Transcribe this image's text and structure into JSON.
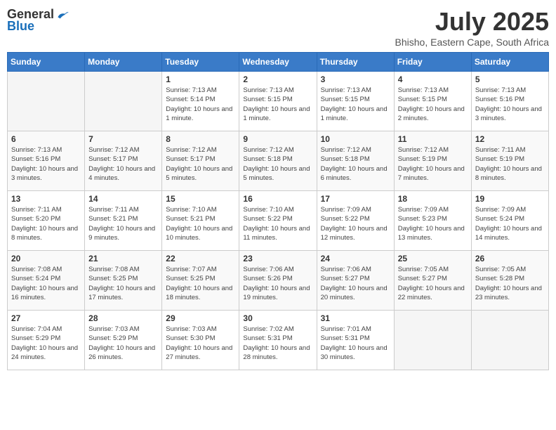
{
  "logo": {
    "general": "General",
    "blue": "Blue"
  },
  "title": "July 2025",
  "location": "Bhisho, Eastern Cape, South Africa",
  "weekdays": [
    "Sunday",
    "Monday",
    "Tuesday",
    "Wednesday",
    "Thursday",
    "Friday",
    "Saturday"
  ],
  "weeks": [
    [
      {
        "day": "",
        "info": ""
      },
      {
        "day": "",
        "info": ""
      },
      {
        "day": "1",
        "info": "Sunrise: 7:13 AM\nSunset: 5:14 PM\nDaylight: 10 hours and 1 minute."
      },
      {
        "day": "2",
        "info": "Sunrise: 7:13 AM\nSunset: 5:15 PM\nDaylight: 10 hours and 1 minute."
      },
      {
        "day": "3",
        "info": "Sunrise: 7:13 AM\nSunset: 5:15 PM\nDaylight: 10 hours and 1 minute."
      },
      {
        "day": "4",
        "info": "Sunrise: 7:13 AM\nSunset: 5:15 PM\nDaylight: 10 hours and 2 minutes."
      },
      {
        "day": "5",
        "info": "Sunrise: 7:13 AM\nSunset: 5:16 PM\nDaylight: 10 hours and 3 minutes."
      }
    ],
    [
      {
        "day": "6",
        "info": "Sunrise: 7:13 AM\nSunset: 5:16 PM\nDaylight: 10 hours and 3 minutes."
      },
      {
        "day": "7",
        "info": "Sunrise: 7:12 AM\nSunset: 5:17 PM\nDaylight: 10 hours and 4 minutes."
      },
      {
        "day": "8",
        "info": "Sunrise: 7:12 AM\nSunset: 5:17 PM\nDaylight: 10 hours and 5 minutes."
      },
      {
        "day": "9",
        "info": "Sunrise: 7:12 AM\nSunset: 5:18 PM\nDaylight: 10 hours and 5 minutes."
      },
      {
        "day": "10",
        "info": "Sunrise: 7:12 AM\nSunset: 5:18 PM\nDaylight: 10 hours and 6 minutes."
      },
      {
        "day": "11",
        "info": "Sunrise: 7:12 AM\nSunset: 5:19 PM\nDaylight: 10 hours and 7 minutes."
      },
      {
        "day": "12",
        "info": "Sunrise: 7:11 AM\nSunset: 5:19 PM\nDaylight: 10 hours and 8 minutes."
      }
    ],
    [
      {
        "day": "13",
        "info": "Sunrise: 7:11 AM\nSunset: 5:20 PM\nDaylight: 10 hours and 8 minutes."
      },
      {
        "day": "14",
        "info": "Sunrise: 7:11 AM\nSunset: 5:21 PM\nDaylight: 10 hours and 9 minutes."
      },
      {
        "day": "15",
        "info": "Sunrise: 7:10 AM\nSunset: 5:21 PM\nDaylight: 10 hours and 10 minutes."
      },
      {
        "day": "16",
        "info": "Sunrise: 7:10 AM\nSunset: 5:22 PM\nDaylight: 10 hours and 11 minutes."
      },
      {
        "day": "17",
        "info": "Sunrise: 7:09 AM\nSunset: 5:22 PM\nDaylight: 10 hours and 12 minutes."
      },
      {
        "day": "18",
        "info": "Sunrise: 7:09 AM\nSunset: 5:23 PM\nDaylight: 10 hours and 13 minutes."
      },
      {
        "day": "19",
        "info": "Sunrise: 7:09 AM\nSunset: 5:24 PM\nDaylight: 10 hours and 14 minutes."
      }
    ],
    [
      {
        "day": "20",
        "info": "Sunrise: 7:08 AM\nSunset: 5:24 PM\nDaylight: 10 hours and 16 minutes."
      },
      {
        "day": "21",
        "info": "Sunrise: 7:08 AM\nSunset: 5:25 PM\nDaylight: 10 hours and 17 minutes."
      },
      {
        "day": "22",
        "info": "Sunrise: 7:07 AM\nSunset: 5:25 PM\nDaylight: 10 hours and 18 minutes."
      },
      {
        "day": "23",
        "info": "Sunrise: 7:06 AM\nSunset: 5:26 PM\nDaylight: 10 hours and 19 minutes."
      },
      {
        "day": "24",
        "info": "Sunrise: 7:06 AM\nSunset: 5:27 PM\nDaylight: 10 hours and 20 minutes."
      },
      {
        "day": "25",
        "info": "Sunrise: 7:05 AM\nSunset: 5:27 PM\nDaylight: 10 hours and 22 minutes."
      },
      {
        "day": "26",
        "info": "Sunrise: 7:05 AM\nSunset: 5:28 PM\nDaylight: 10 hours and 23 minutes."
      }
    ],
    [
      {
        "day": "27",
        "info": "Sunrise: 7:04 AM\nSunset: 5:29 PM\nDaylight: 10 hours and 24 minutes."
      },
      {
        "day": "28",
        "info": "Sunrise: 7:03 AM\nSunset: 5:29 PM\nDaylight: 10 hours and 26 minutes."
      },
      {
        "day": "29",
        "info": "Sunrise: 7:03 AM\nSunset: 5:30 PM\nDaylight: 10 hours and 27 minutes."
      },
      {
        "day": "30",
        "info": "Sunrise: 7:02 AM\nSunset: 5:31 PM\nDaylight: 10 hours and 28 minutes."
      },
      {
        "day": "31",
        "info": "Sunrise: 7:01 AM\nSunset: 5:31 PM\nDaylight: 10 hours and 30 minutes."
      },
      {
        "day": "",
        "info": ""
      },
      {
        "day": "",
        "info": ""
      }
    ]
  ]
}
